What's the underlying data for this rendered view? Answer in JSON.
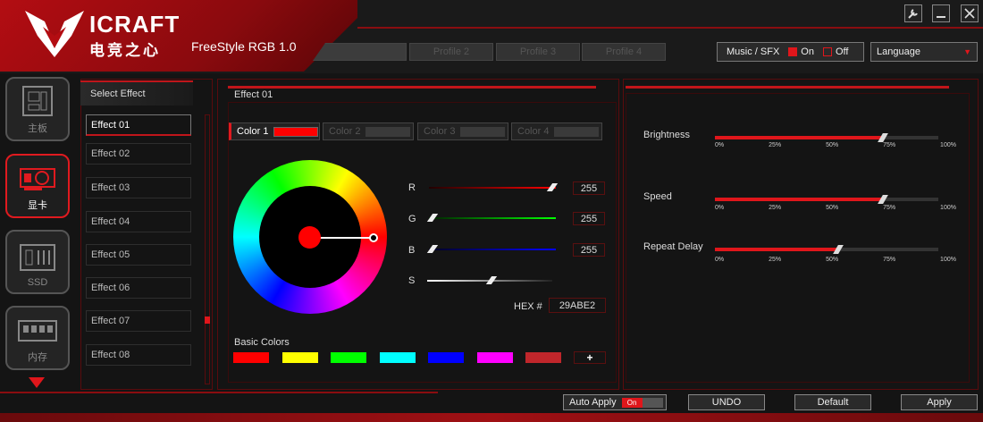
{
  "header": {
    "brand": "ICRAFT",
    "brand_cn": "电竞之心",
    "app_title": "FreeStyle RGB 1.0",
    "profile_tabs": [
      {
        "label": ""
      },
      {
        "label": "Profile 2"
      },
      {
        "label": "Profile 3"
      },
      {
        "label": "Profile 4"
      }
    ],
    "music_label": "Music / SFX",
    "music_on": "On",
    "music_off": "Off",
    "language": "Language"
  },
  "window_icons": [
    "wrench-icon",
    "minimize-icon",
    "close-icon"
  ],
  "sidebar": {
    "items": [
      {
        "label": "主板",
        "icon": "motherboard-icon"
      },
      {
        "label": "显卡",
        "icon": "gpu-icon"
      },
      {
        "label": "SSD",
        "icon": "ssd-icon"
      },
      {
        "label": "内存",
        "icon": "memory-icon"
      }
    ]
  },
  "effects": {
    "heading": "Select Effect",
    "items": [
      "Effect 01",
      "Effect 02",
      "Effect 03",
      "Effect 04",
      "Effect 05",
      "Effect 06",
      "Effect 07",
      "Effect 08"
    ]
  },
  "editor": {
    "title": "Effect 01",
    "colors": [
      "Color 1",
      "Color 2",
      "Color 3",
      "Color 4"
    ],
    "r_label": "R",
    "g_label": "G",
    "b_label": "B",
    "s_label": "S",
    "r": "255",
    "g": "255",
    "b": "255",
    "hex_label": "HEX #",
    "hex": "29ABE2",
    "basic_colors_label": "Basic Colors",
    "basic_colors": [
      "#ff0000",
      "#ffff00",
      "#00ff00",
      "#00ffff",
      "#0000ff",
      "#ff00ff",
      "#c0262b"
    ],
    "add_label": "+"
  },
  "settings": {
    "ticks": [
      "0%",
      "25%",
      "50%",
      "75%",
      "100%"
    ],
    "sliders": [
      {
        "label": "Brightness",
        "value_pct": 75
      },
      {
        "label": "Speed",
        "value_pct": 75
      },
      {
        "label": "Repeat Delay",
        "value_pct": 55
      }
    ]
  },
  "footer": {
    "auto_apply": "Auto Apply",
    "toggle_on": "On",
    "undo": "UNDO",
    "default": "Default",
    "apply": "Apply"
  },
  "colors": {
    "accent": "#e0161b",
    "selected": "#ff0000"
  }
}
